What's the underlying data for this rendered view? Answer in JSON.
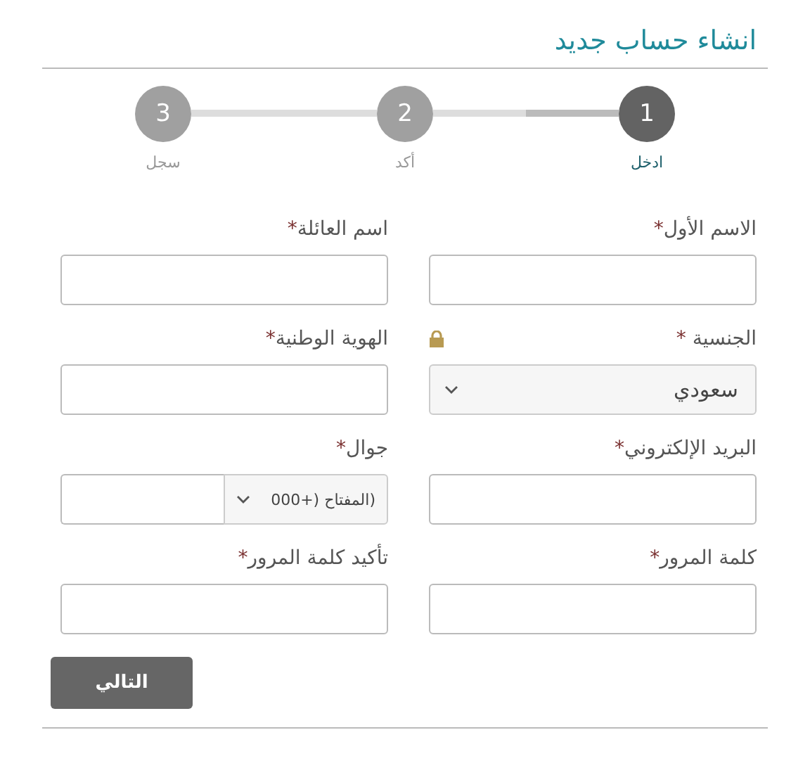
{
  "title": "انشاء حساب جديد",
  "steps": [
    {
      "number": "1",
      "label": "ادخل",
      "selected": true
    },
    {
      "number": "2",
      "label": "أكد",
      "selected": false
    },
    {
      "number": "3",
      "label": "سجل",
      "selected": false
    }
  ],
  "progress": {
    "level": 0.5
  },
  "fields": [
    {
      "kind": "text",
      "label": "الاسم الأول",
      "mark": "*"
    },
    {
      "kind": "text",
      "label": "اسم العائلة",
      "mark": "*"
    },
    {
      "kind": "select",
      "label": "الجنسية ",
      "mark": "*",
      "value": "سعودي",
      "locked": true
    },
    {
      "kind": "text",
      "label": "الهوية الوطنية",
      "mark": "*"
    },
    {
      "kind": "text",
      "label": "البريد الإلكتروني",
      "mark": "*"
    },
    {
      "kind": "phone",
      "label": "جوال",
      "mark": "*",
      "code": "(المفتاح (+000"
    },
    {
      "kind": "text",
      "label": "كلمة المرور",
      "mark": "*"
    },
    {
      "kind": "text",
      "label": "تأكيد كلمة المرور",
      "mark": "*"
    }
  ],
  "next_button": "التالي"
}
